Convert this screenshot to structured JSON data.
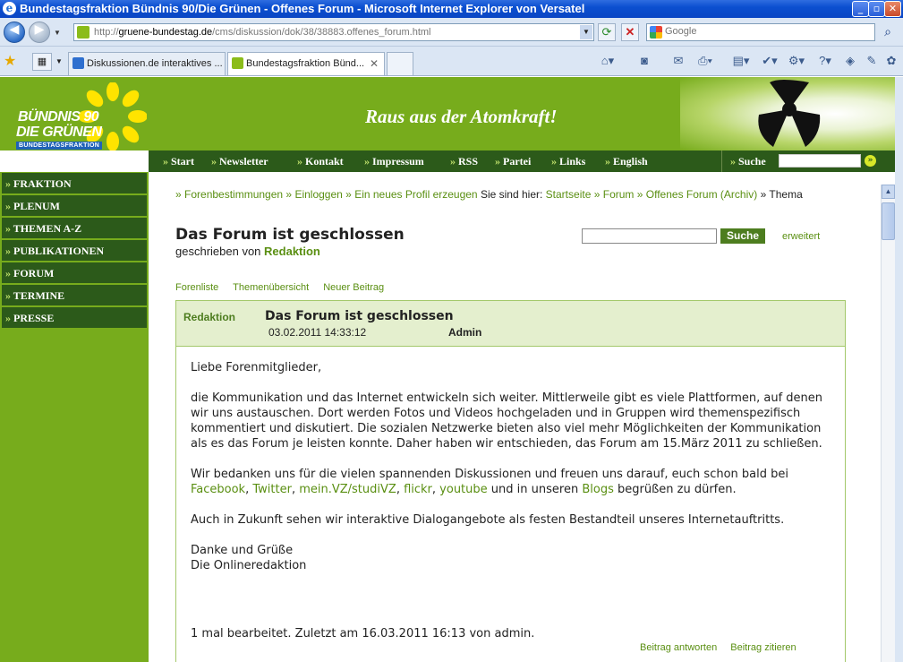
{
  "window": {
    "title": "Bundestagsfraktion Bündnis 90/Die Grünen - Offenes Forum - Microsoft Internet Explorer von Versatel",
    "minimize": "_",
    "restore": "▫",
    "close": "✕"
  },
  "address": {
    "url_prefix": "http://",
    "url_domain": "gruene-bundestag.de",
    "url_path": "/cms/diskussion/dok/38/38883.offenes_forum.html"
  },
  "search": {
    "placeholder": "Google"
  },
  "tabs": [
    {
      "label": "Diskussionen.de interaktives ...",
      "active": false
    },
    {
      "label": "Bundestagsfraktion Bünd...",
      "active": true
    }
  ],
  "site": {
    "logo_line1": "BÜNDNIS 90",
    "logo_line2": "DIE GRÜNEN",
    "logo_sub": "BUNDESTAGSFRAKTION",
    "slogan": "Raus aus der Atomkraft!"
  },
  "topnav": {
    "items": [
      "Start",
      "Newsletter",
      "Kontakt",
      "Impressum",
      "RSS",
      "Partei",
      "Links",
      "English"
    ],
    "search_label": "Suche"
  },
  "sidebar": {
    "items": [
      "FRAKTION",
      "PLENUM",
      "THEMEN A-Z",
      "PUBLIKATIONEN",
      "FORUM",
      "TERMINE",
      "PRESSE"
    ]
  },
  "breadcrumbs": {
    "links": [
      "Forenbestimmungen",
      "Einloggen",
      "Ein neues Profil erzeugen"
    ],
    "location_label": "Sie sind hier:",
    "path": [
      "Startseite",
      "Forum",
      "Offenes Forum (Archiv)"
    ],
    "current": "Thema"
  },
  "heading": {
    "title": "Das Forum ist geschlossen",
    "byline_prefix": "geschrieben von",
    "byline_author": "Redaktion"
  },
  "forum_search": {
    "button": "Suche",
    "advanced": "erweitert"
  },
  "forum_links": [
    "Forenliste",
    "Themenübersicht",
    "Neuer Beitrag"
  ],
  "post": {
    "author": "Redaktion",
    "subject": "Das Forum ist geschlossen",
    "date": "03.02.2011 14:33:12",
    "role": "Admin",
    "greeting": "Liebe Forenmitglieder,",
    "para1": "die Kommunikation und das Internet entwickeln sich weiter. Mittlerweile gibt es viele Plattformen, auf denen wir uns austauschen. Dort werden Fotos und Videos hochgeladen und in Gruppen wird themenspezifisch kommentiert und diskutiert. Die sozialen Netzwerke bieten also viel mehr Möglichkeiten der Kommunikation als es das Forum je leisten konnte. Daher haben wir entschieden, das Forum am 15.März 2011 zu schließen.",
    "para2_start": "Wir bedanken uns für die vielen spannenden Diskussionen und freuen uns darauf, euch schon bald bei",
    "para2_links": [
      "Facebook",
      "Twitter",
      "mein.VZ/studiVZ",
      "flickr",
      "youtube"
    ],
    "para2_mid": "und in unseren",
    "para2_blogs": "Blogs",
    "para2_end": "begrüßen zu dürfen.",
    "para3": "Auch in Zukunft sehen wir interaktive Dialogangebote als festen Bestandteil unseres Internetauftritts.",
    "closing1": "Danke und Grüße",
    "closing2": "Die Onlineredaktion",
    "edited": "1 mal bearbeitet. Zuletzt am 16.03.2011 16:13 von admin.",
    "actions": [
      "Beitrag antworten",
      "Beitrag zitieren"
    ]
  }
}
